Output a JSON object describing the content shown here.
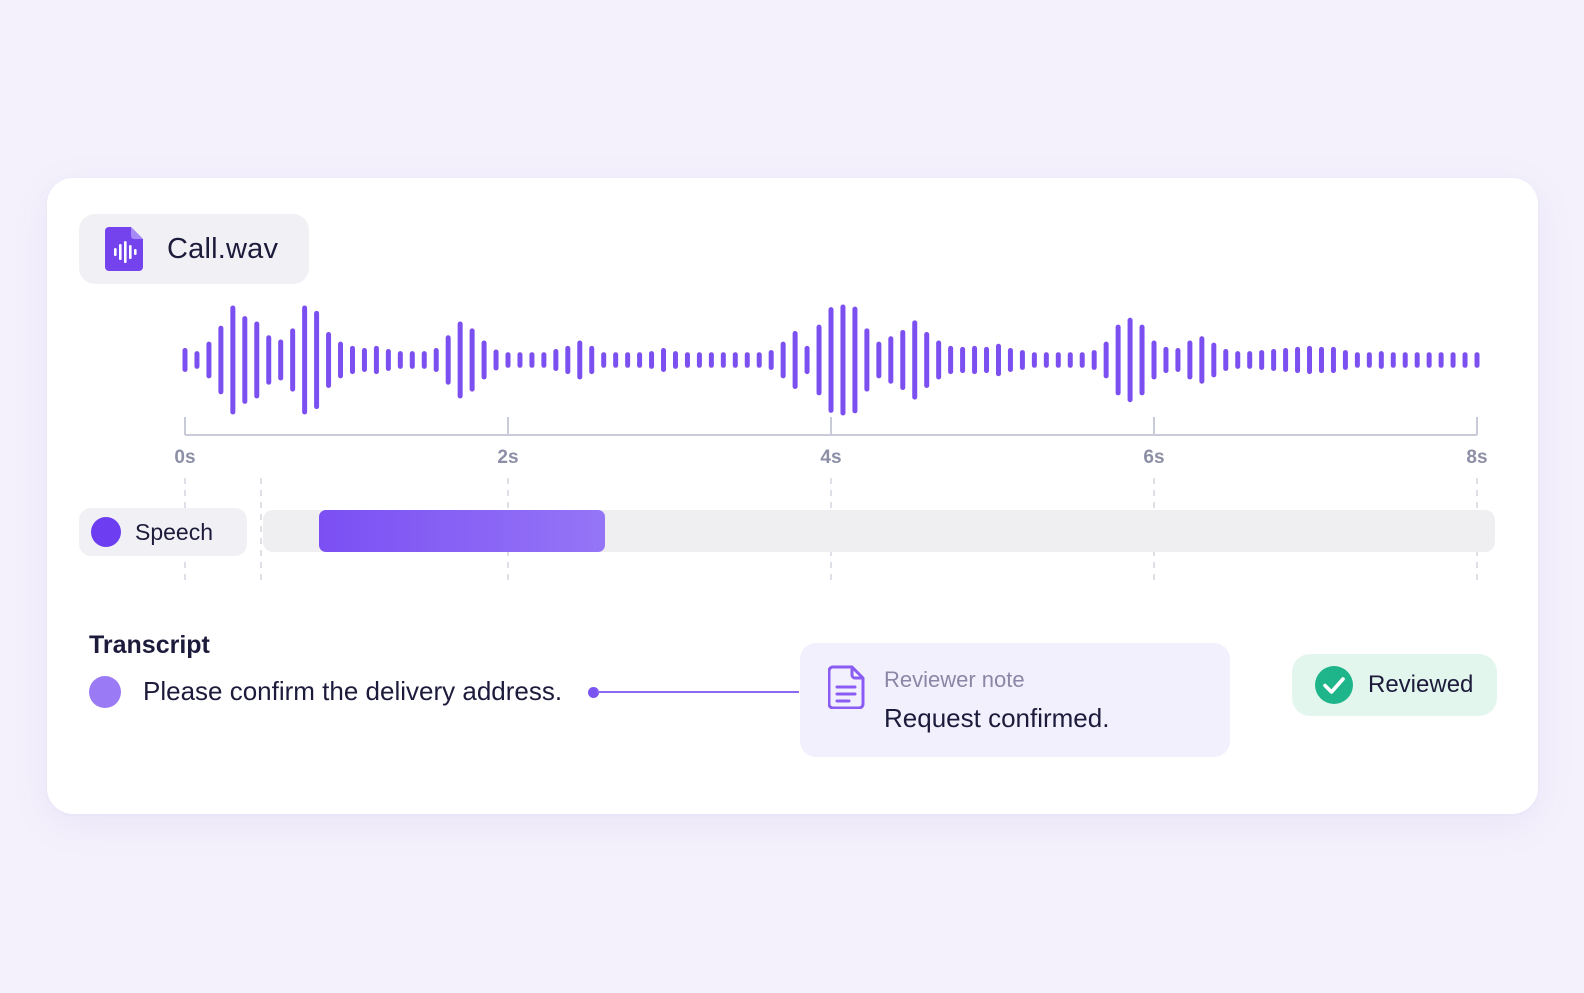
{
  "file": {
    "name": "Call.wav",
    "icon": "audio-file-icon"
  },
  "waveform": {
    "duration_s": 8,
    "amplitudes": [
      0.18,
      0.12,
      0.3,
      0.6,
      0.98,
      0.78,
      0.68,
      0.42,
      0.34,
      0.55,
      0.98,
      0.88,
      0.48,
      0.3,
      0.22,
      0.18,
      0.22,
      0.16,
      0.12,
      0.12,
      0.12,
      0.18,
      0.42,
      0.68,
      0.55,
      0.32,
      0.15,
      0.1,
      0.1,
      0.1,
      0.1,
      0.16,
      0.22,
      0.32,
      0.22,
      0.1,
      0.1,
      0.1,
      0.1,
      0.12,
      0.18,
      0.12,
      0.1,
      0.1,
      0.1,
      0.1,
      0.1,
      0.1,
      0.1,
      0.14,
      0.3,
      0.5,
      0.22,
      0.62,
      0.95,
      1.0,
      0.96,
      0.55,
      0.3,
      0.4,
      0.52,
      0.7,
      0.48,
      0.32,
      0.22,
      0.2,
      0.22,
      0.2,
      0.26,
      0.18,
      0.14,
      0.1,
      0.1,
      0.1,
      0.1,
      0.1,
      0.14,
      0.3,
      0.62,
      0.75,
      0.62,
      0.32,
      0.2,
      0.18,
      0.32,
      0.4,
      0.28,
      0.16,
      0.12,
      0.12,
      0.14,
      0.16,
      0.18,
      0.2,
      0.22,
      0.2,
      0.2,
      0.14,
      0.1,
      0.1,
      0.12,
      0.1,
      0.1,
      0.1,
      0.1,
      0.1,
      0.1,
      0.1,
      0.1
    ]
  },
  "axis": {
    "ticks": [
      {
        "value": 0,
        "label": "0s"
      },
      {
        "value": 2,
        "label": "2s"
      },
      {
        "value": 4,
        "label": "4s"
      },
      {
        "value": 6,
        "label": "6s"
      },
      {
        "value": 8,
        "label": "8s"
      }
    ]
  },
  "speech": {
    "label": "Speech",
    "segment": {
      "start_s": 0.83,
      "end_s": 2.6
    }
  },
  "transcript": {
    "title": "Transcript",
    "text": "Please confirm the delivery address."
  },
  "note": {
    "label": "Reviewer note",
    "text": "Request confirmed.",
    "icon": "document-icon"
  },
  "status": {
    "label": "Reviewed",
    "icon": "check-circle-icon"
  },
  "colors": {
    "accent": "#6d3df2",
    "wave": "#7b4ff0",
    "success": "#1fb58a",
    "background": "#f4f1fc"
  }
}
